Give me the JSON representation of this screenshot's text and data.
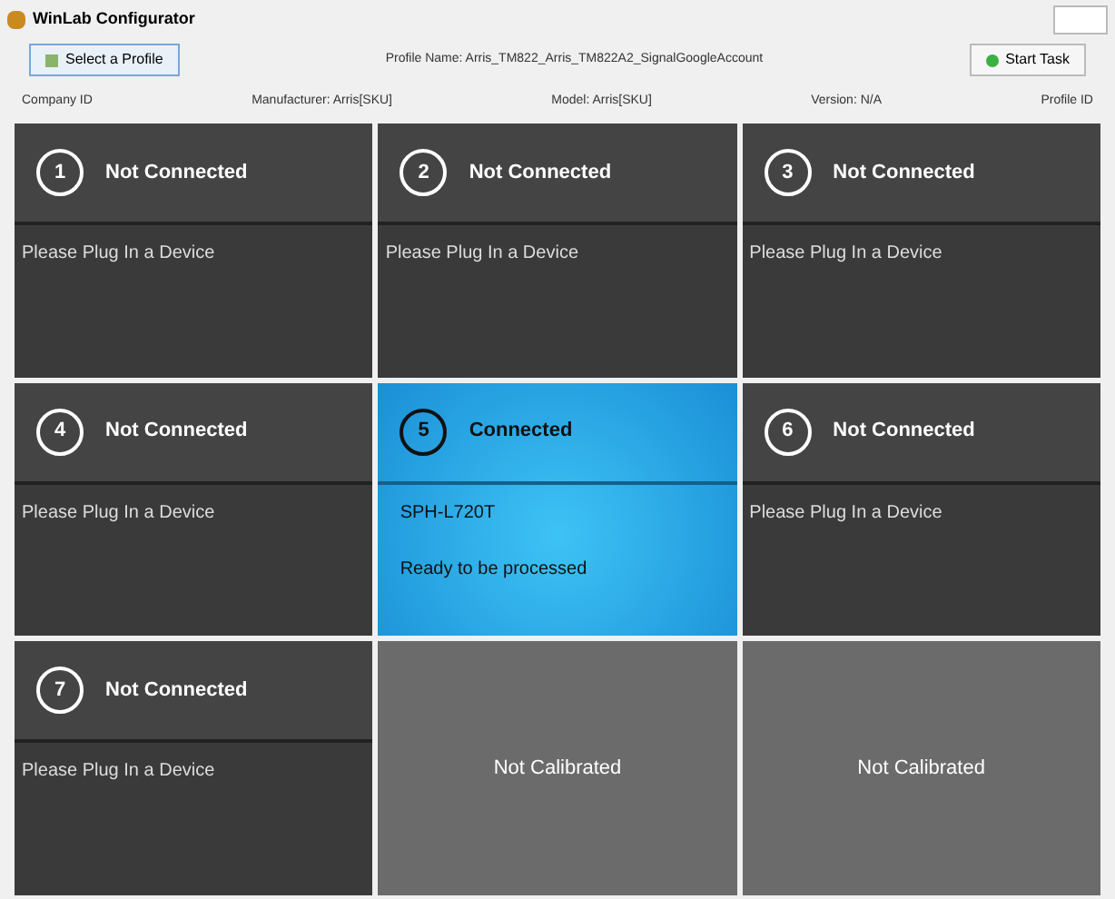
{
  "window": {
    "title": "WinLab Configurator"
  },
  "toolbar": {
    "profile_button": "Select a Profile",
    "profile_name": "Profile Name: Arris_TM822_Arris_TM822A2_SignalGoogleAccount",
    "start_button": "Start Task"
  },
  "info": [
    "Company ID",
    "Manufacturer: Arris[SKU]",
    "Model: Arris[SKU]",
    "Version: N/A",
    "Profile ID"
  ],
  "slots": [
    {
      "kind": "device",
      "number": "1",
      "status": "Not Connected",
      "connected": false,
      "lines": [
        "Please Plug In a Device"
      ]
    },
    {
      "kind": "device",
      "number": "2",
      "status": "Not Connected",
      "connected": false,
      "lines": [
        "Please Plug In a Device"
      ]
    },
    {
      "kind": "device",
      "number": "3",
      "status": "Not Connected",
      "connected": false,
      "lines": [
        "Please Plug In a Device"
      ]
    },
    {
      "kind": "device",
      "number": "4",
      "status": "Not Connected",
      "connected": false,
      "lines": [
        "Please Plug In a Device"
      ]
    },
    {
      "kind": "device",
      "number": "5",
      "status": "Connected",
      "connected": true,
      "lines": [
        "SPH-L720T",
        "Ready to be processed"
      ]
    },
    {
      "kind": "device",
      "number": "6",
      "status": "Not Connected",
      "connected": false,
      "lines": [
        "Please Plug In a Device"
      ]
    },
    {
      "kind": "device",
      "number": "7",
      "status": "Not Connected",
      "connected": false,
      "lines": [
        "Please Plug In a Device"
      ]
    },
    {
      "kind": "uncalibrated",
      "text": "Not Calibrated"
    },
    {
      "kind": "uncalibrated",
      "text": "Not Calibrated"
    }
  ]
}
